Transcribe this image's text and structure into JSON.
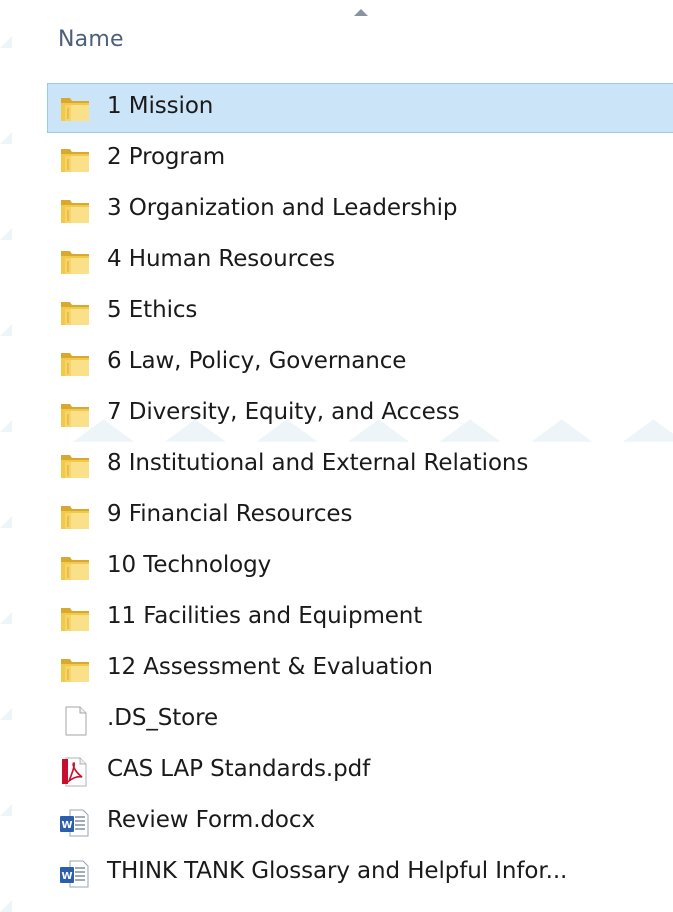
{
  "header": {
    "name_column": "Name"
  },
  "items": [
    {
      "label": "1 Mission",
      "type": "folder",
      "selected": true
    },
    {
      "label": "2 Program",
      "type": "folder"
    },
    {
      "label": "3 Organization and Leadership",
      "type": "folder"
    },
    {
      "label": "4 Human Resources",
      "type": "folder"
    },
    {
      "label": "5 Ethics",
      "type": "folder"
    },
    {
      "label": "6 Law, Policy, Governance",
      "type": "folder"
    },
    {
      "label": "7 Diversity, Equity, and Access",
      "type": "folder"
    },
    {
      "label": "8 Institutional and External Relations",
      "type": "folder"
    },
    {
      "label": "9 Financial Resources",
      "type": "folder"
    },
    {
      "label": "10 Technology",
      "type": "folder"
    },
    {
      "label": "11 Facilities and Equipment",
      "type": "folder"
    },
    {
      "label": "12 Assessment & Evaluation",
      "type": "folder"
    },
    {
      "label": ".DS_Store",
      "type": "file"
    },
    {
      "label": "CAS LAP Standards.pdf",
      "type": "pdf"
    },
    {
      "label": "Review Form.docx",
      "type": "docx"
    },
    {
      "label": "THINK TANK Glossary and Helpful Infor...",
      "type": "docx"
    }
  ],
  "colors": {
    "selection_bg": "#cce4f7",
    "selection_border": "#99c9ef",
    "header_text": "#4c607a",
    "watermark": "#eaf3f6"
  },
  "icons": {
    "folder": "folder-icon",
    "file": "generic-file-icon",
    "pdf": "pdf-file-icon",
    "docx": "word-doc-icon"
  }
}
